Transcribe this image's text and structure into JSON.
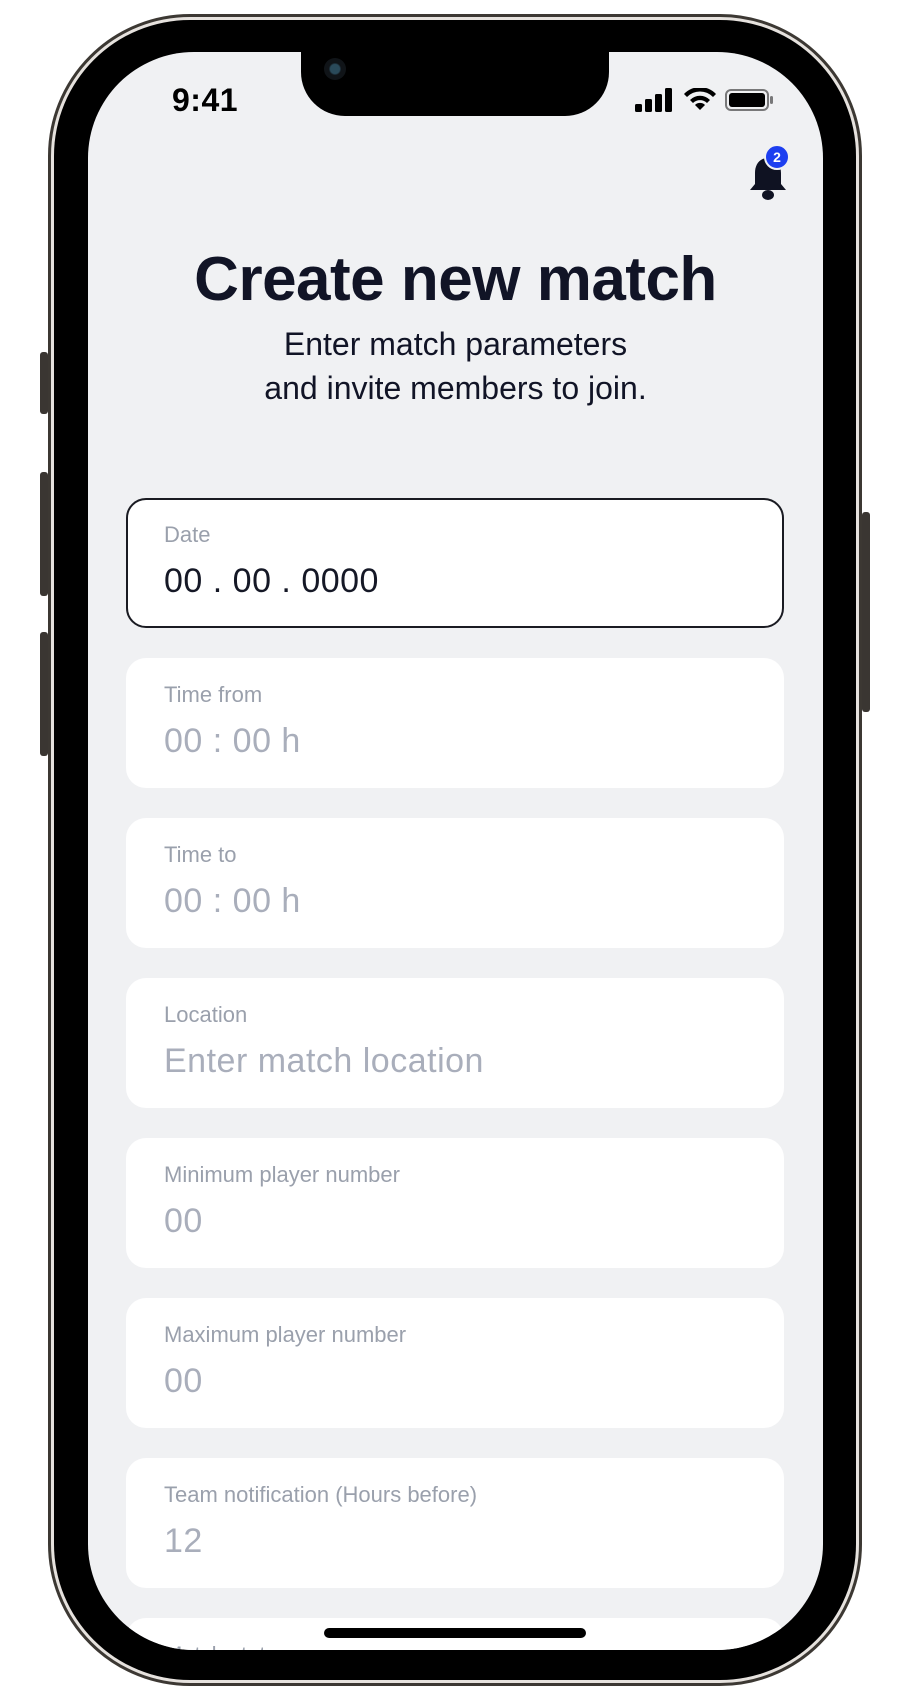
{
  "status_bar": {
    "time": "9:41",
    "icons": [
      "signal-icon",
      "wifi-icon",
      "battery-icon"
    ]
  },
  "notifications": {
    "icon": "bell-icon",
    "badge_count": "2",
    "badge_color": "#1d3ff0"
  },
  "header": {
    "title": "Create new match",
    "subtitle_line1": "Enter match parameters",
    "subtitle_line2": "and invite members to join."
  },
  "form": {
    "fields": [
      {
        "label": "Date",
        "value": "00 . 00 . 0000",
        "active": true
      },
      {
        "label": "Time from",
        "value": "00 : 00 h"
      },
      {
        "label": "Time to",
        "value": "00 : 00 h"
      },
      {
        "label": "Location",
        "value": "Enter match location"
      },
      {
        "label": "Minimum player number",
        "value": "00"
      },
      {
        "label": "Maximum player number",
        "value": "00"
      },
      {
        "label": "Team notification (Hours before)",
        "value": "12"
      },
      {
        "label": "Match status",
        "value": ""
      }
    ]
  },
  "colors": {
    "background": "#f0f1f3",
    "text_primary": "#111426",
    "text_placeholder": "#a9aebb",
    "accent": "#1d3ff0"
  }
}
